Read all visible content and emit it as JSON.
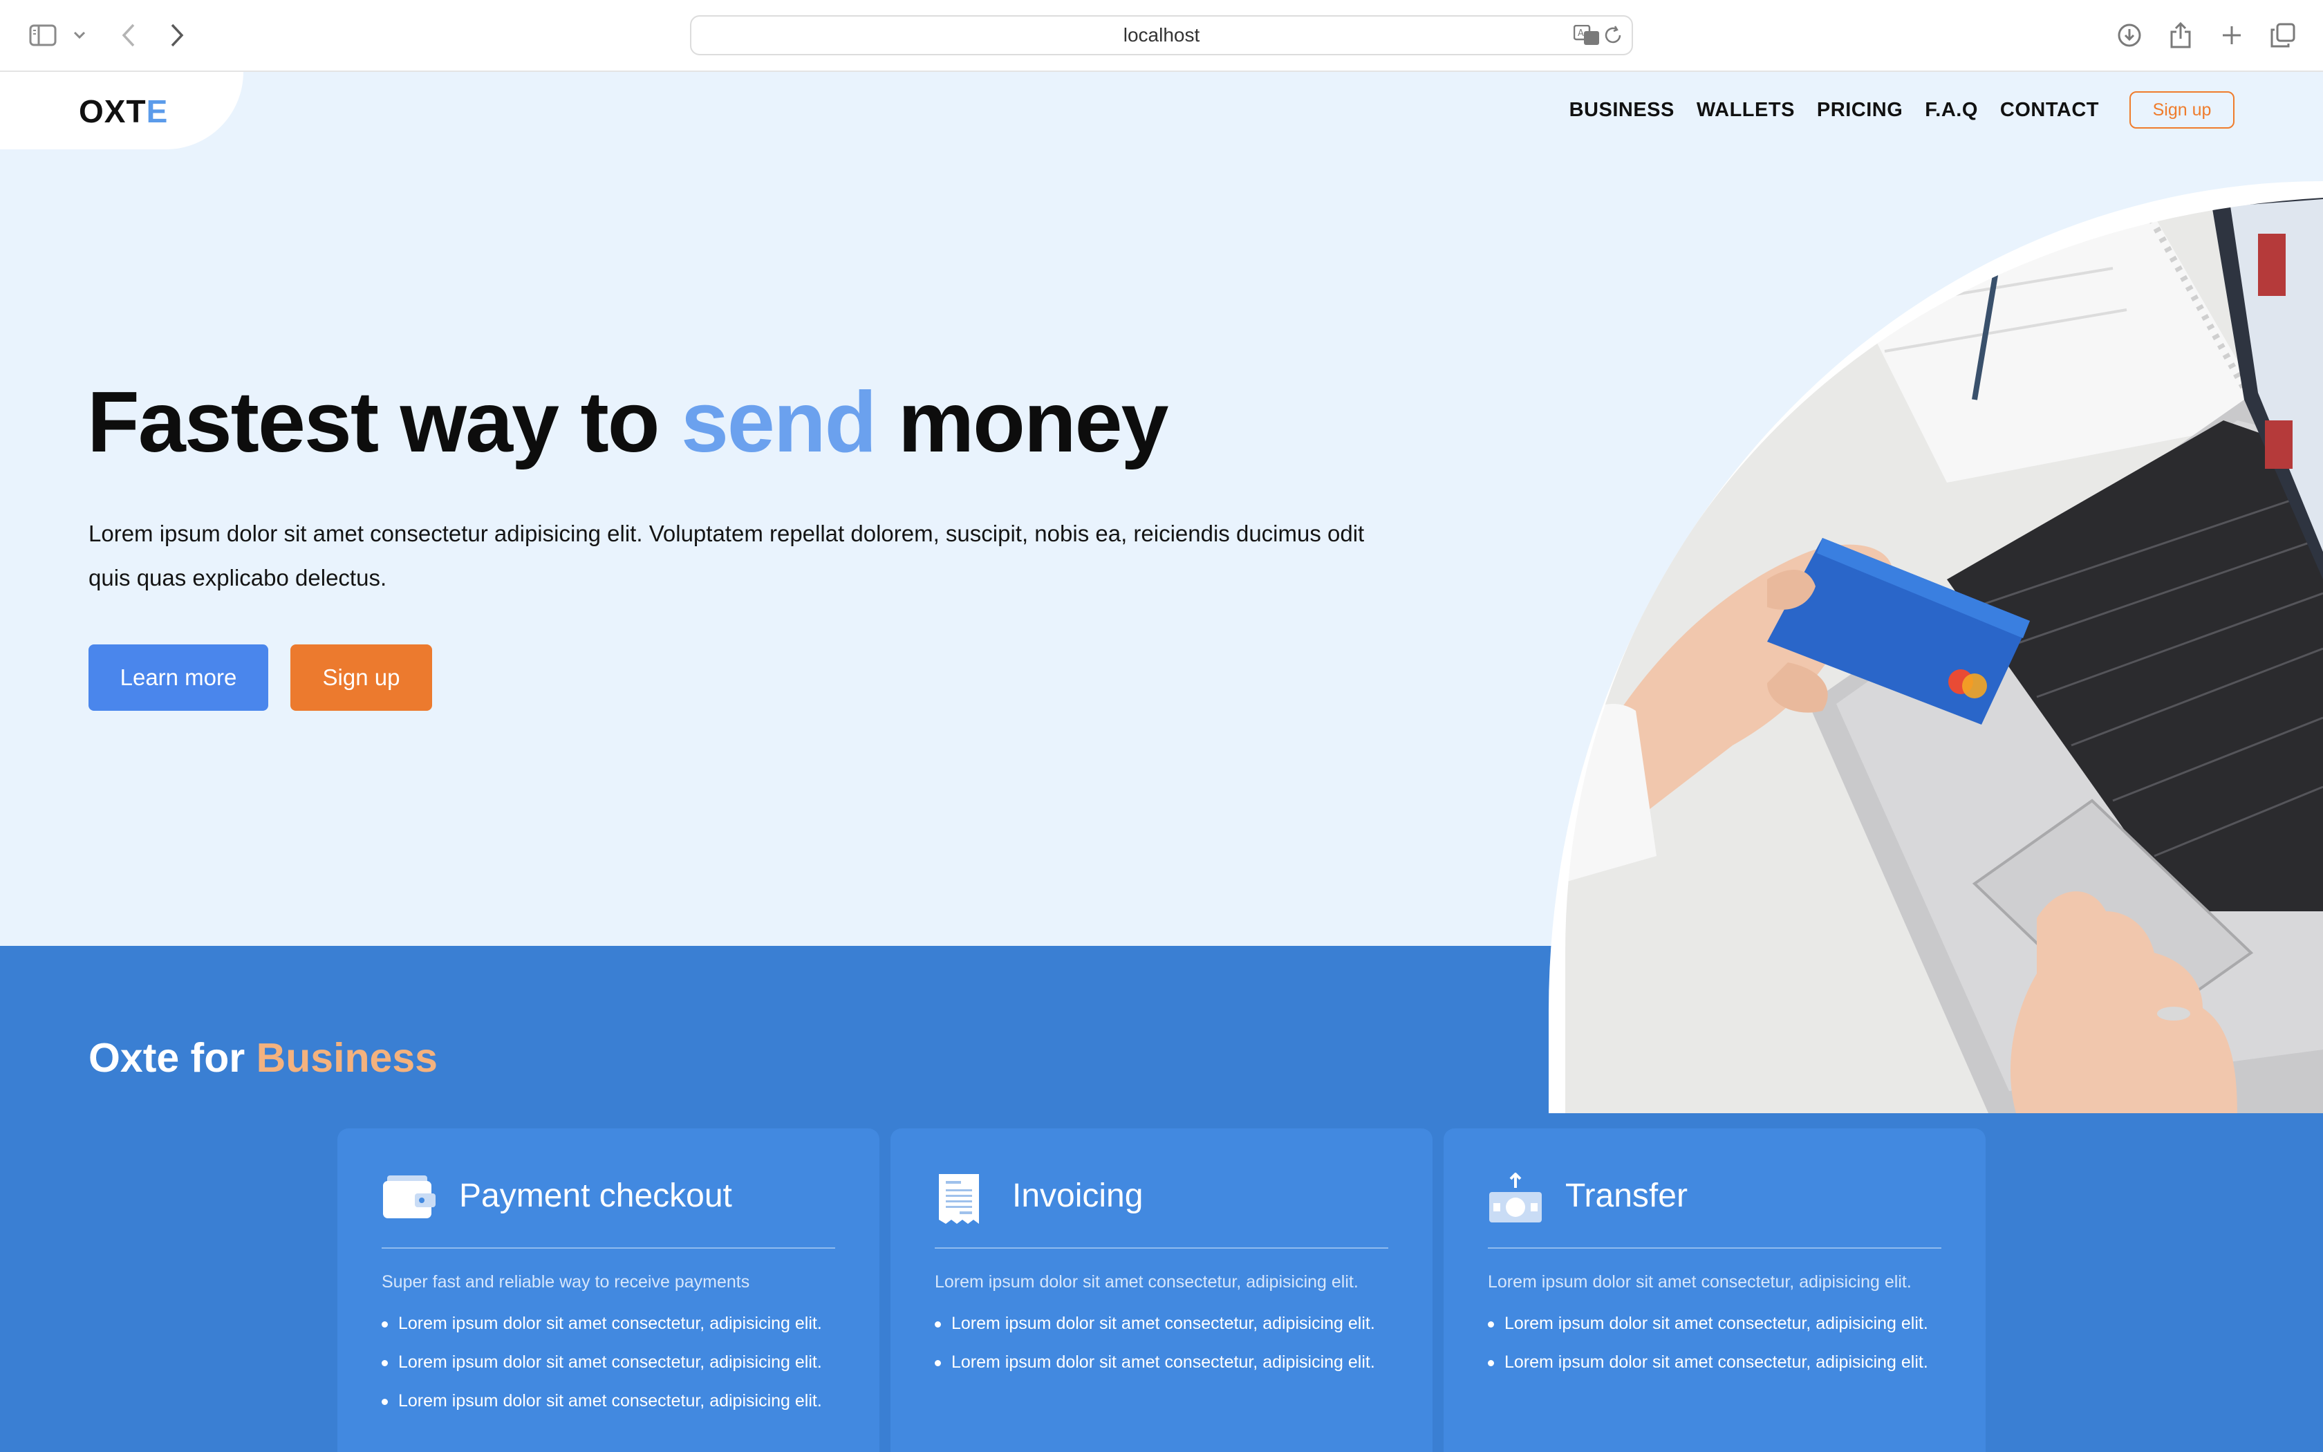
{
  "browser": {
    "url": "localhost",
    "icons": [
      "sidebar-icon",
      "chevron-down-icon",
      "back-icon",
      "forward-icon",
      "translate-icon",
      "reload-icon",
      "download-icon",
      "share-icon",
      "new-tab-icon",
      "tabs-overview-icon"
    ]
  },
  "site": {
    "logo": {
      "main": "OXT",
      "accent": "E"
    },
    "nav": {
      "items": [
        "BUSINESS",
        "WALLETS",
        "PRICING",
        "F.A.Q",
        "CONTACT"
      ],
      "signup": "Sign up"
    }
  },
  "hero": {
    "title_before": "Fastest way to ",
    "title_accent": "send",
    "title_after": " money",
    "text": "Lorem ipsum dolor sit amet consectetur adipisicing elit. Voluptatem repellat dolorem, suscipit, nobis ea, reiciendis ducimus odit quis quas explicabo delectus.",
    "learn_more": "Learn more",
    "signup": "Sign up",
    "image": "photo of hands holding a credit card over a laptop keyboard"
  },
  "business": {
    "title_main": "Oxte for ",
    "title_accent": "Business",
    "cards": [
      {
        "icon": "wallet-icon",
        "title": "Payment checkout",
        "subtitle": "Super fast and reliable way to receive payments",
        "bullets": [
          "Lorem ipsum dolor sit amet consectetur, adipisicing elit.",
          "Lorem ipsum dolor sit amet consectetur, adipisicing elit.",
          "Lorem ipsum dolor sit amet consectetur, adipisicing elit."
        ]
      },
      {
        "icon": "invoice-icon",
        "title": "Invoicing",
        "subtitle": "Lorem ipsum dolor sit amet consectetur, adipisicing elit.",
        "bullets": [
          "Lorem ipsum dolor sit amet consectetur, adipisicing elit.",
          "Lorem ipsum dolor sit amet consectetur, adipisicing elit."
        ]
      },
      {
        "icon": "money-transfer-icon",
        "title": "Transfer",
        "subtitle": "Lorem ipsum dolor sit amet consectetur, adipisicing elit.",
        "bullets": [
          "Lorem ipsum dolor sit amet consectetur, adipisicing elit.",
          "Lorem ipsum dolor sit amet consectetur, adipisicing elit."
        ]
      }
    ]
  },
  "colors": {
    "primary": "#4a86ec",
    "accent": "#ec7a2e",
    "hero_bg": "#e9f3fd",
    "business_bg": "#3a7fd3",
    "card_bg": "#4289e0"
  }
}
